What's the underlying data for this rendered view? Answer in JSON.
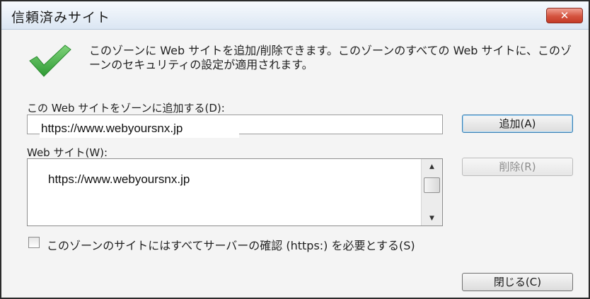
{
  "window": {
    "title": "信頼済みサイト",
    "close_glyph": "✕"
  },
  "info": {
    "text": "このゾーンに Web サイトを追加/削除できます。このゾーンのすべての Web サイトに、このゾーンのセキュリティの設定が適用されます。"
  },
  "add_site": {
    "label": "この Web サイトをゾーンに追加する(D):",
    "value": "https://www.webyoursnx.jp",
    "button_label": "追加(A)"
  },
  "sites": {
    "label": "Web サイト(W):",
    "items": [
      "https://www.webyoursnx.jp"
    ],
    "remove_label": "削除(R)",
    "scroll_up_glyph": "▲",
    "scroll_down_glyph": "▼"
  },
  "https_checkbox": {
    "label": "このゾーンのサイトにはすべてサーバーの確認 (https:) を必要とする(S)",
    "checked": false
  },
  "footer": {
    "close_label": "閉じる(C)"
  },
  "colors": {
    "check_green": "#3aa83a",
    "close_button_red": "#c43b27",
    "titlebar": "#dbe6f3"
  },
  "icons": {
    "status": "checkmark-icon"
  }
}
